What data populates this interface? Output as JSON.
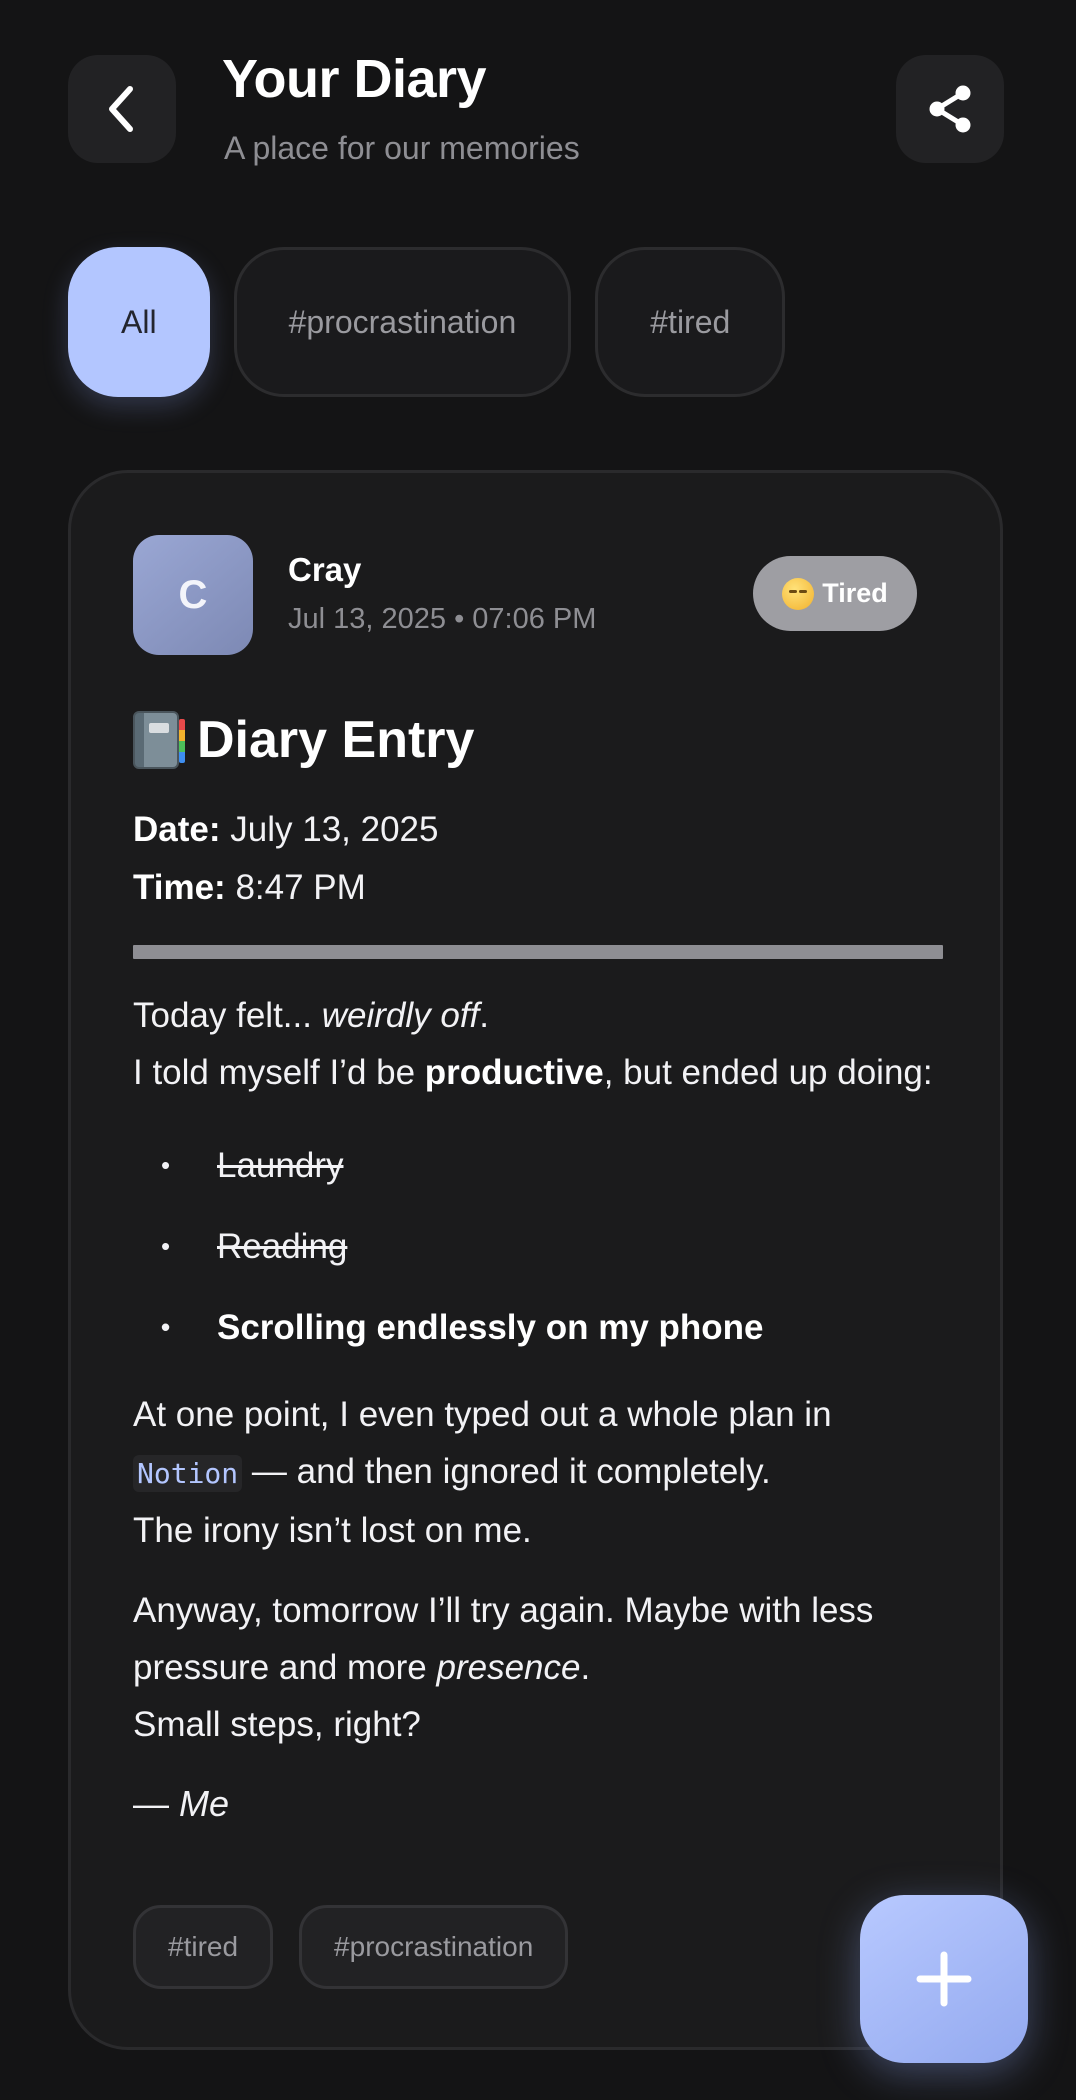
{
  "header": {
    "title": "Your Diary",
    "subtitle": "A place for our memories",
    "back_icon": "chevron-left-icon",
    "share_icon": "share-icon"
  },
  "filters": [
    {
      "label": "All",
      "active": true
    },
    {
      "label": "#procrastination",
      "active": false
    },
    {
      "label": "#tired",
      "active": false
    }
  ],
  "entry": {
    "author_initial": "C",
    "author": "Cray",
    "timestamp": "Jul 13, 2025 • 07:06 PM",
    "mood": {
      "label": "Tired",
      "icon": "sleepy-face-icon"
    },
    "heading": "Diary Entry",
    "heading_icon": "notebook-icon",
    "date_label": "Date:",
    "date_value": "July 13, 2025",
    "time_label": "Time:",
    "time_value": "8:47 PM",
    "para1": {
      "a": "Today felt... ",
      "a_em": "weirdly off",
      "a_end": ".",
      "b": "I told myself I’d be ",
      "b_strong": "productive",
      "b_end": ", but ended up doing:"
    },
    "todo": [
      {
        "text": "Laundry",
        "style": "done"
      },
      {
        "text": "Reading",
        "style": "done"
      },
      {
        "text": "Scrolling endlessly on my phone",
        "style": "bold"
      }
    ],
    "para2": {
      "a": "At one point, I even typed out a whole plan in ",
      "code": "Notion",
      "a_end": " — and then ignored it completely.",
      "b": "The irony isn’t lost on me."
    },
    "para3": {
      "a": "Anyway, tomorrow I’ll try again. Maybe with less pressure and more ",
      "a_em": "presence",
      "a_end": ".",
      "b": "Small steps, right?"
    },
    "signature_dash": "— ",
    "signature_name": "Me",
    "tags": [
      "#tired",
      "#procrastination"
    ]
  },
  "fab": {
    "icon": "plus-icon"
  },
  "colors": {
    "background": "#141415",
    "card": "#1b1b1c",
    "accent": "#b3c6ff",
    "muted_text": "#8e8e93",
    "mood_badge": "#9e9ea3"
  }
}
